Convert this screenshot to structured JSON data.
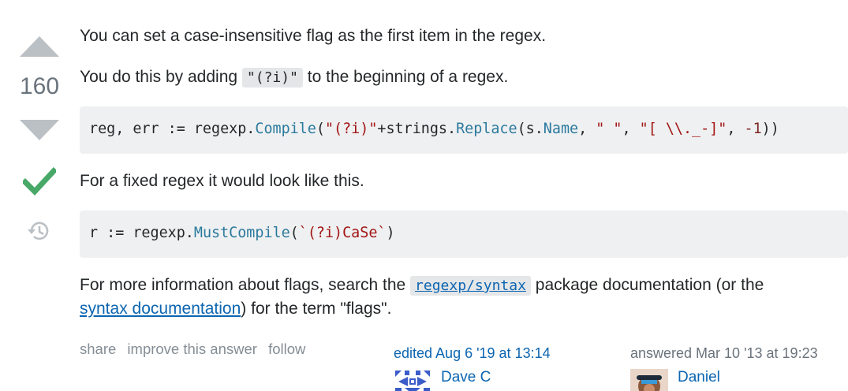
{
  "vote": {
    "count": "160",
    "upvote_icon": "arrow-up-icon",
    "downvote_icon": "arrow-down-icon",
    "accepted_icon": "checkmark-icon",
    "history_icon": "history-icon",
    "muted_color": "#bbc0c4",
    "accepted_color": "#48a868"
  },
  "answer": {
    "p1": "You can set a case-insensitive flag as the first item in the regex.",
    "p2_before": "You do this by adding",
    "p2_code": "\"(?i)\"",
    "p2_after": "to the beginning of a regex.",
    "code1": {
      "t1": "reg, err := regexp.",
      "t2": "Compile",
      "t3": "(",
      "t4": "\"(?i)\"",
      "t5": "+strings.",
      "t6": "Replace",
      "t7": "(s.",
      "t8": "Name",
      "t9": ", ",
      "t10": "\" \"",
      "t11": ", ",
      "t12": "\"[ \\\\._-]\"",
      "t13": ", ",
      "t14": "-1",
      "t15": "))"
    },
    "p3": "For a fixed regex it would look like this.",
    "code2": {
      "t1": "r := regexp.",
      "t2": "MustCompile",
      "t3": "(",
      "t4": "`(?i)CaSe`",
      "t5": ")"
    },
    "p4_before": "For more information about flags, search the",
    "p4_link_code": "regexp/syntax",
    "p4_middle": "package documentation (or the",
    "p4_link2": "syntax documentation",
    "p4_after": ") for the term \"flags\"."
  },
  "menu": {
    "share": "share",
    "improve": "improve this answer",
    "follow": "follow"
  },
  "edited": {
    "action": "edited Aug 6 '19 at 13:14",
    "user": "Dave C",
    "avatar": "identicon-avatar"
  },
  "answered": {
    "action": "answered Mar 10 '13 at 19:23",
    "user": "Daniel",
    "avatar": "photo-avatar"
  }
}
